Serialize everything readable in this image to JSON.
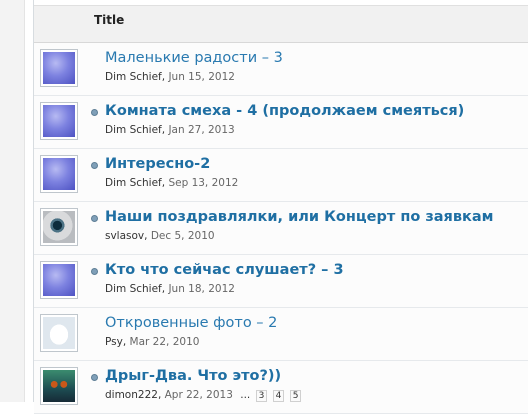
{
  "header": {
    "title": "Title"
  },
  "rows": [
    {
      "title": "Маленькие радости – 3",
      "author": "Dim Schief",
      "date": "Jun 15, 2012",
      "unread": false,
      "thumb": "blue-texture"
    },
    {
      "title": "Комната смеха - 4 (продолжаем смеяться)",
      "author": "Dim Schief",
      "date": "Jan 27, 2013",
      "unread": true,
      "thumb": "blue-texture"
    },
    {
      "title": "Интересно-2",
      "author": "Dim Schief",
      "date": "Sep 13, 2012",
      "unread": true,
      "thumb": "blue-texture"
    },
    {
      "title": "Наши поздравлялки, или Концерт по заявкам",
      "author": "svlasov",
      "date": "Dec 5, 2010",
      "unread": true,
      "thumb": "eye-avatar"
    },
    {
      "title": "Кто что сейчас слушает? – 3",
      "author": "Dim Schief",
      "date": "Jun 18, 2012",
      "unread": true,
      "thumb": "blue-texture"
    },
    {
      "title": "Откровенные фото – 2",
      "author": "Psy",
      "date": "Mar 22, 2010",
      "unread": false,
      "thumb": "cat-avatar"
    },
    {
      "title": "Дрыг-Два. Что это?))",
      "author": "dimon222",
      "date": "Apr 22, 2013",
      "unread": true,
      "thumb": "glasses-avatar",
      "pages": [
        "...",
        "3",
        "4",
        "5"
      ]
    }
  ]
}
